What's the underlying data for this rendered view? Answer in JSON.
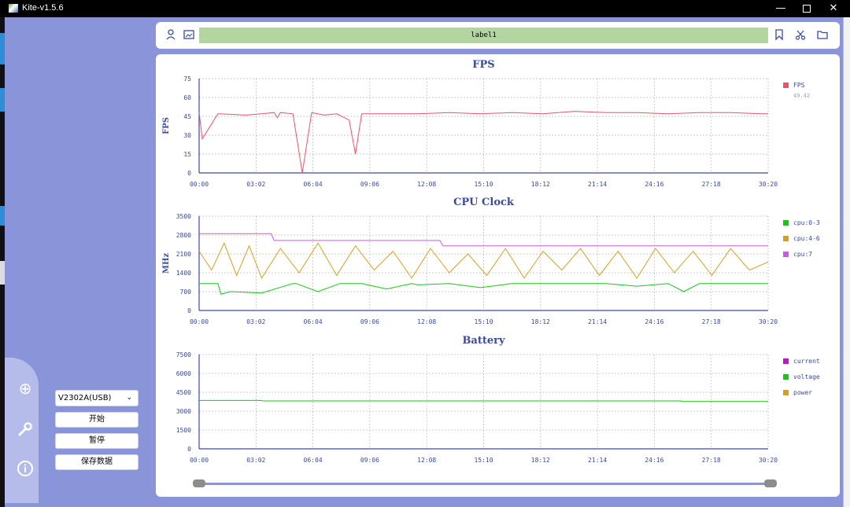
{
  "window": {
    "title": "Kite-v1.5.6",
    "min_glyph": "—",
    "close_glyph": "✕"
  },
  "toolbar": {
    "icons": [
      "person-icon",
      "image-icon",
      "bookmark-icon",
      "scissors-icon",
      "folder-icon"
    ],
    "label": "label1"
  },
  "sidebar": {
    "icons": [
      "add-circle-icon",
      "wrench-icon",
      "info-icon"
    ],
    "device": "V2302A(USB)",
    "start_label": "开始",
    "pause_label": "暂停",
    "save_label": "保存数据"
  },
  "colors": {
    "background": "#8a94d9",
    "grid": "#b9b9b9",
    "axis": "#3a4aa0",
    "label": "#b3d5a0"
  },
  "chart_data": [
    {
      "type": "line",
      "title": "FPS",
      "ylabel": "FPS",
      "ylim": [
        0,
        75
      ],
      "yticks": [
        0,
        15,
        30,
        45,
        60,
        75
      ],
      "xticks": [
        "00:00",
        "03:02",
        "06:04",
        "09:06",
        "12:08",
        "15:10",
        "18:12",
        "21:14",
        "24:16",
        "27:18",
        "30:20"
      ],
      "xlim_seconds": [
        0,
        1820
      ],
      "grid": true,
      "legend_position": "right",
      "series": [
        {
          "name": "FPS",
          "color": "#e8546a",
          "current_value": "49.42",
          "x": [
            0,
            10,
            60,
            150,
            200,
            240,
            250,
            260,
            300,
            330,
            360,
            400,
            440,
            480,
            500,
            520,
            600,
            700,
            800,
            900,
            1000,
            1100,
            1200,
            1300,
            1400,
            1500,
            1600,
            1700,
            1800,
            1820
          ],
          "y": [
            48,
            27,
            47,
            46,
            47,
            48,
            44,
            48,
            47,
            0,
            48,
            46,
            47,
            42,
            15,
            47,
            47,
            47,
            48,
            47,
            48,
            47,
            49,
            48,
            48,
            47,
            48,
            48,
            47,
            47
          ]
        }
      ]
    },
    {
      "type": "line",
      "title": "CPU Clock",
      "ylabel": "MHz",
      "ylim": [
        0,
        3500
      ],
      "yticks": [
        0,
        700,
        1400,
        2100,
        2800,
        3500
      ],
      "xticks": [
        "00:00",
        "03:02",
        "06:04",
        "09:06",
        "12:08",
        "15:10",
        "18:12",
        "21:14",
        "24:16",
        "27:18",
        "30:20"
      ],
      "xlim_seconds": [
        0,
        1820
      ],
      "grid": true,
      "legend_position": "right",
      "series": [
        {
          "name": "cpu:0-3",
          "color": "#14c814",
          "x": [
            0,
            60,
            70,
            100,
            200,
            300,
            310,
            380,
            450,
            520,
            600,
            680,
            700,
            800,
            900,
            1000,
            1100,
            1200,
            1300,
            1400,
            1500,
            1550,
            1600,
            1700,
            1800,
            1820
          ],
          "y": [
            1000,
            1000,
            600,
            700,
            650,
            1000,
            1000,
            700,
            1000,
            1000,
            800,
            1000,
            950,
            1000,
            850,
            1000,
            1000,
            1000,
            1000,
            900,
            1000,
            700,
            1000,
            1000,
            1000,
            1000
          ]
        },
        {
          "name": "cpu:4-6",
          "color": "#d4a020",
          "x": [
            0,
            40,
            80,
            120,
            160,
            200,
            260,
            320,
            380,
            440,
            500,
            560,
            620,
            680,
            740,
            800,
            860,
            920,
            980,
            1040,
            1100,
            1160,
            1220,
            1280,
            1340,
            1400,
            1460,
            1520,
            1580,
            1640,
            1700,
            1760,
            1820
          ],
          "y": [
            2200,
            1500,
            2500,
            1300,
            2400,
            1200,
            2300,
            1400,
            2500,
            1300,
            2400,
            1500,
            2200,
            1200,
            2300,
            1400,
            2100,
            1300,
            2300,
            1200,
            2200,
            1500,
            2300,
            1300,
            2200,
            1200,
            2300,
            1400,
            2200,
            1300,
            2300,
            1500,
            1800
          ]
        },
        {
          "name": "cpu:7",
          "color": "#c85ae6",
          "x": [
            0,
            230,
            240,
            770,
            780,
            1820
          ],
          "y": [
            2850,
            2850,
            2600,
            2600,
            2400,
            2400
          ]
        }
      ]
    },
    {
      "type": "line",
      "title": "Battery",
      "ylim": [
        0,
        7500
      ],
      "yticks": [
        0,
        1500,
        3000,
        4500,
        6000,
        7500
      ],
      "xticks": [
        "00:00",
        "03:02",
        "06:04",
        "09:06",
        "12:08",
        "15:10",
        "18:12",
        "21:14",
        "24:16",
        "27:18",
        "30:20"
      ],
      "xlim_seconds": [
        0,
        1820
      ],
      "grid": true,
      "legend_position": "right",
      "series": [
        {
          "name": "current",
          "color": "#c812c8",
          "x": [],
          "y": []
        },
        {
          "name": "voltage",
          "color": "#14c814",
          "x": [
            0,
            200,
            205,
            1540,
            1545,
            1820
          ],
          "y": [
            3850,
            3850,
            3810,
            3810,
            3770,
            3770
          ]
        },
        {
          "name": "power",
          "color": "#d4a020",
          "x": [],
          "y": []
        }
      ]
    }
  ],
  "slider": {
    "range_start": 0,
    "range_end": 1
  }
}
